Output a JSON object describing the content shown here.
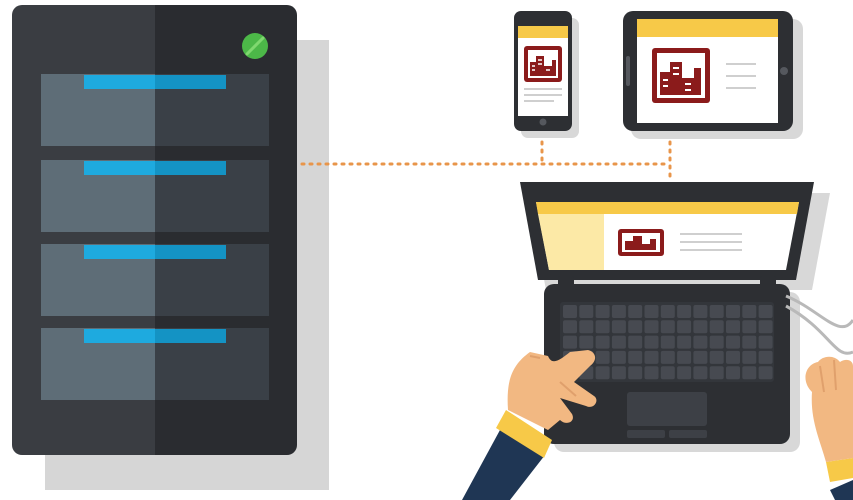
{
  "scene": {
    "server": {
      "slot_count": 4,
      "status_light": "on",
      "colors": {
        "body_light": "#3a3d42",
        "body_dark": "#2a2c30",
        "slot_light": "#5e6d77",
        "slot_dark": "#3a4047",
        "slot_indicator": "#1eaadf",
        "status_light": "#4cb848",
        "shadow": "#d6d6d6"
      }
    },
    "devices": {
      "phone": {
        "screen_header": "#f7c948",
        "app_icon": "building-icon"
      },
      "tablet": {
        "screen_header": "#f7c948",
        "app_icon": "building-icon"
      },
      "laptop": {
        "screen_header": "#f7c948",
        "app_icon": "building-icon"
      }
    },
    "connections": {
      "style": "dotted",
      "color": "#e8954a"
    },
    "brand_color": "#8b1b1b",
    "accent_color": "#f7c948",
    "skin_color": "#f2b882",
    "sleeve_color": "#1f3654",
    "cuff_color": "#f7c948"
  }
}
